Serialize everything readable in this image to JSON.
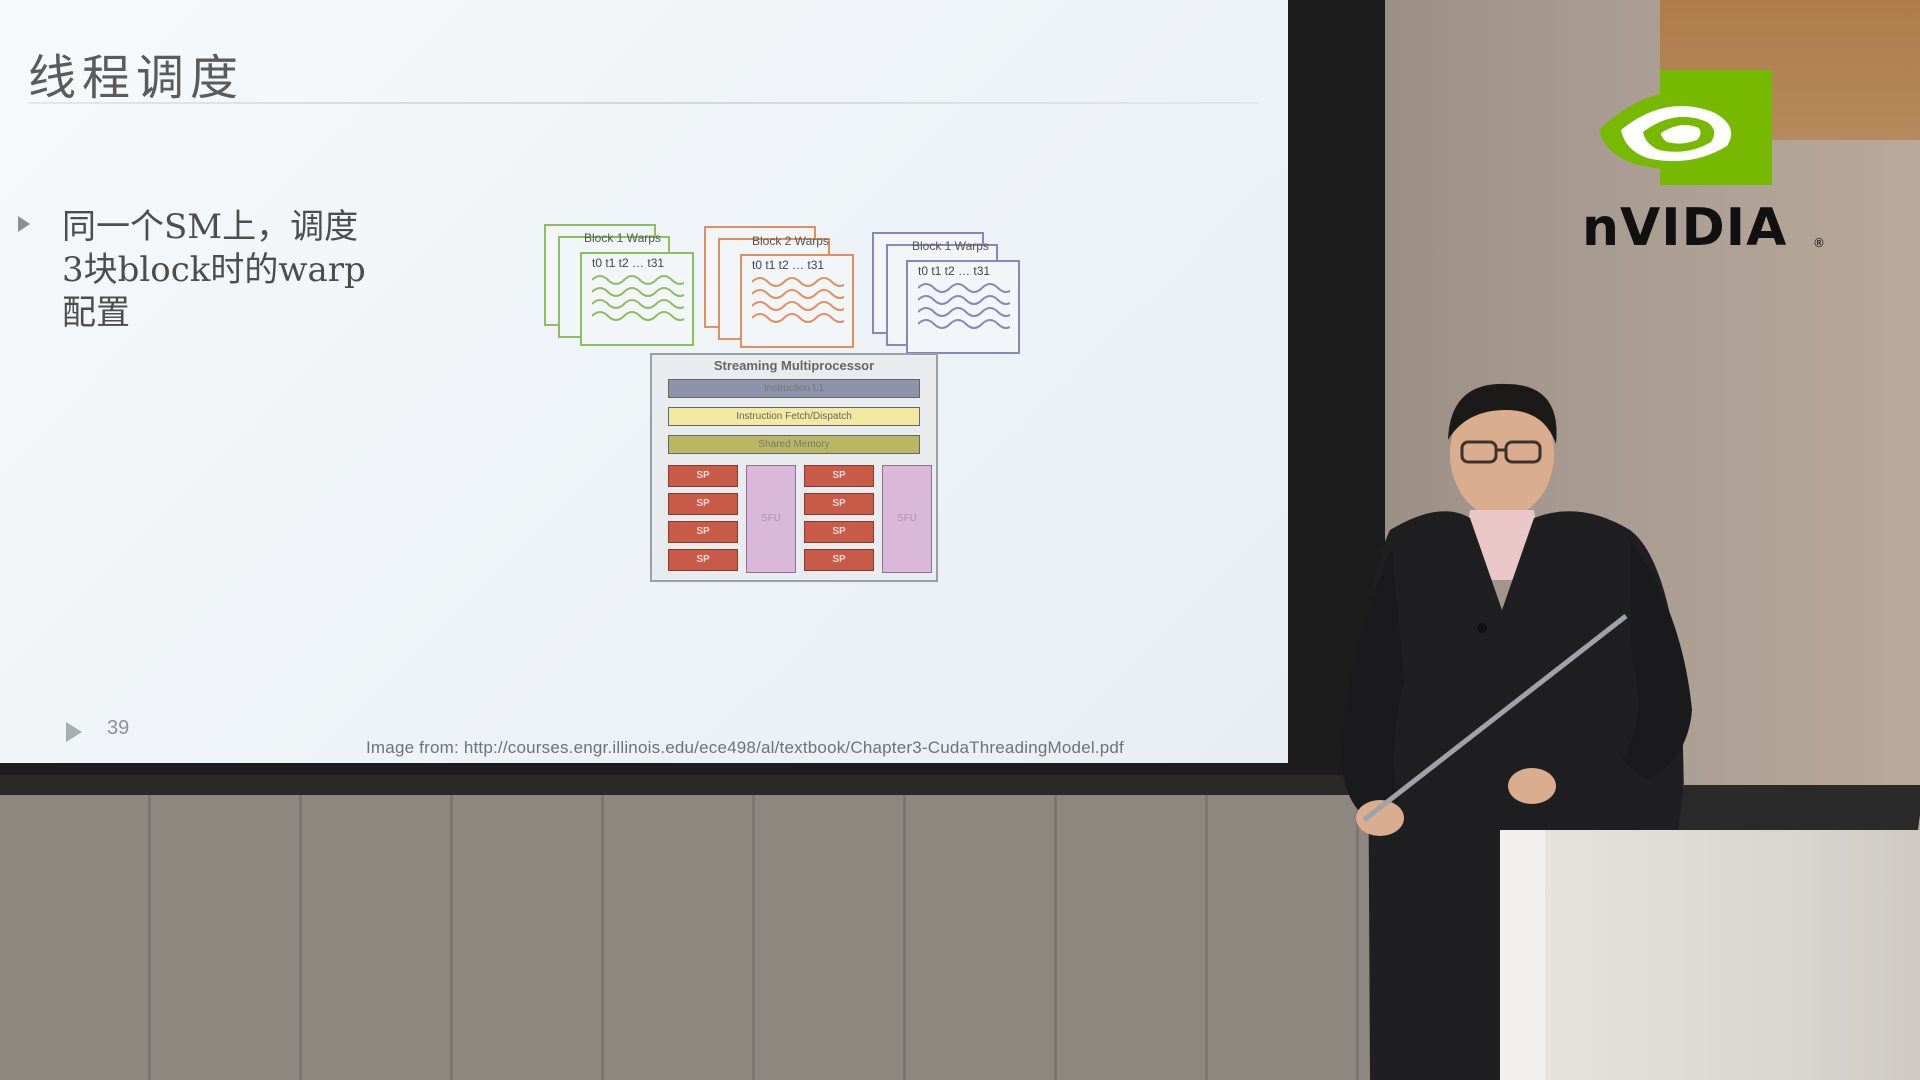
{
  "slide": {
    "title": "线程调度",
    "bullet_lines": [
      "同一个SM上，调度",
      "3块block时的warp",
      "配置"
    ],
    "page_number": "39",
    "credit": "Image from: http://courses.engr.illinois.edu/ece498/al/textbook/Chapter3-CudaThreadingModel.pdf"
  },
  "diagram": {
    "blocks": [
      {
        "label": "Block 1 Warps",
        "threads": "t0 t1 t2 … t31",
        "color": "#8cbf60"
      },
      {
        "label": "Block 2 Warps",
        "threads": "t0 t1 t2 … t31",
        "color": "#e0905f"
      },
      {
        "label": "Block 1 Warps",
        "threads": "t0 t1 t2 … t31",
        "color": "#8a86b8"
      }
    ],
    "sm": {
      "title": "Streaming Multiprocessor",
      "bars": [
        {
          "label": "Instruction L1",
          "color": "#8d93a8"
        },
        {
          "label": "Instruction Fetch/Dispatch",
          "color": "#f3e9a2"
        },
        {
          "label": "Shared Memory",
          "color": "#b8b864"
        }
      ],
      "sp_label": "SP",
      "sfu_label": "SFU"
    }
  },
  "logo": {
    "text": "nVIDIA",
    "tm": "®",
    "green": "#76b900"
  }
}
